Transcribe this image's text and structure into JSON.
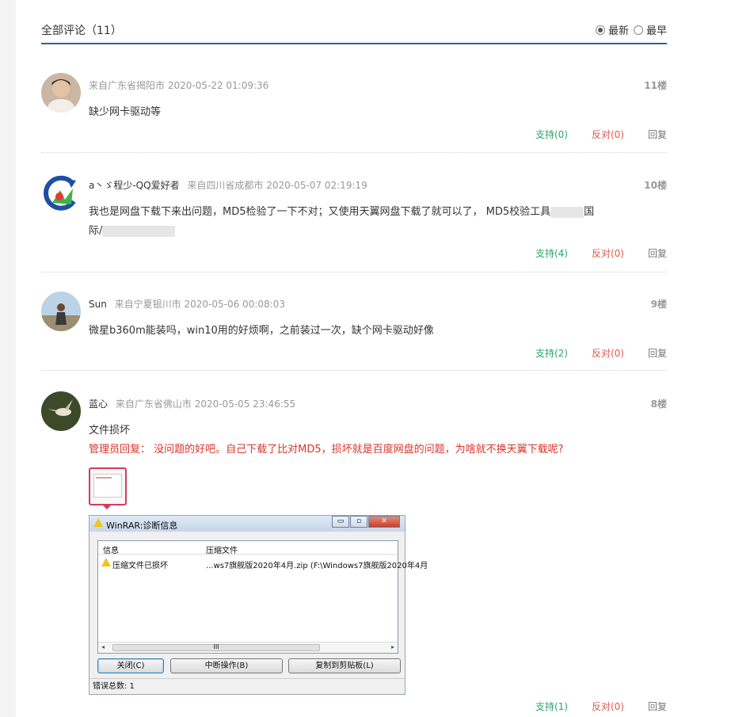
{
  "header": {
    "title": "全部评论（11）",
    "sort_options": [
      {
        "label": "最新",
        "checked": true
      },
      {
        "label": "最早",
        "checked": false
      }
    ]
  },
  "comments": [
    {
      "user": "",
      "location": "来自广东省揭阳市",
      "time": "2020-05-22 01:09:36",
      "floor": "11楼",
      "text": "缺少网卡驱动等",
      "support": "支持(0)",
      "oppose": "反对(0)",
      "reply": "回复"
    },
    {
      "user": "a丶ゞ程少-QQ爱好者",
      "location": "来自四川省成都市",
      "time": "2020-05-07 02:19:19",
      "floor": "10楼",
      "text_line1": "我也是网盘下载下来出问题，MD5检验了一下不对；又使用天翼网盘下载了就可以了， MD5校验工具",
      "text_line1_end": "国",
      "text_line2": "际/",
      "support": "支持(4)",
      "oppose": "反对(0)",
      "reply": "回复"
    },
    {
      "user": "Sun",
      "location": "来自宁夏银川市",
      "time": "2020-05-06 00:08:03",
      "floor": "9楼",
      "text": "微星b360m能装吗，win10用的好烦啊，之前装过一次，缺个网卡驱动好像",
      "support": "支持(2)",
      "oppose": "反对(0)",
      "reply": "回复"
    },
    {
      "user": "蓝心",
      "location": "来自广东省佛山市",
      "time": "2020-05-05 23:46:55",
      "floor": "8楼",
      "text": "文件损坏",
      "admin_reply": "管理员回复：  没问题的好吧。自己下载了比对MD5，损坏就是百度网盘的问题，为啥就不换天翼下载呢?",
      "support": "支持(1)",
      "oppose": "反对(0)",
      "reply": "回复"
    }
  ],
  "winrar": {
    "title": "WinRAR:诊断信息",
    "col_info": "信息",
    "col_archive": "压缩文件",
    "row_info": "压缩文件已损坏",
    "row_archive": "...ws7旗舰版2020年4月.zip (F:\\Windows7旗舰版2020年4月",
    "btn_close": "关闭(C)",
    "btn_abort": "中断操作(B)",
    "btn_copy": "复制到剪贴板(L)",
    "scroll_grip": "III",
    "status": "错误总数: 1",
    "btn_min": "▭",
    "btn_max": "▫",
    "btn_x": "✕"
  },
  "colors": {
    "accent": "#2f5f9e",
    "support": "#2aa56b",
    "oppose": "#e0584e",
    "admin": "#d9342b"
  }
}
